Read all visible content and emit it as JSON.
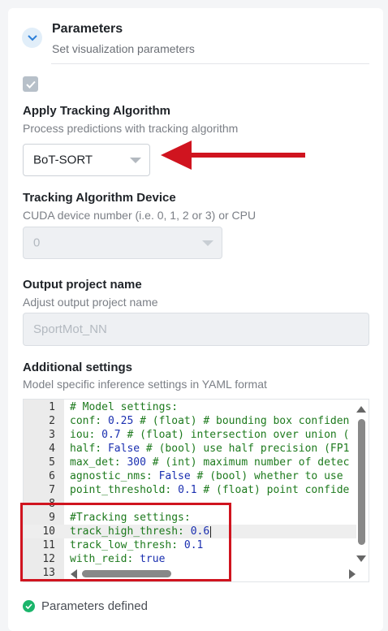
{
  "section": {
    "title": "Parameters",
    "subtitle": "Set visualization parameters"
  },
  "tracking": {
    "label": "Apply Tracking Algorithm",
    "description": "Process predictions with tracking algorithm",
    "enabled": true,
    "algorithm_value": "BoT-SORT"
  },
  "device": {
    "label": "Tracking Algorithm Device",
    "description": "CUDA device number (i.e. 0, 1, 2 or 3) or CPU",
    "value": "0"
  },
  "output": {
    "label": "Output project name",
    "description": "Adjust output project name",
    "placeholder": "SportMot_NN"
  },
  "additional": {
    "label": "Additional settings",
    "description": "Model specific inference settings in YAML format",
    "lines": [
      {
        "n": "1",
        "text": "# Model settings:"
      },
      {
        "n": "2",
        "text": "conf: 0.25 # (float) # bounding box confiden"
      },
      {
        "n": "3",
        "text": "iou: 0.7 # (float) intersection over union ("
      },
      {
        "n": "4",
        "text": "half: False # (bool) use half precision (FP1"
      },
      {
        "n": "5",
        "text": "max_det: 300 # (int) maximum number of detec"
      },
      {
        "n": "6",
        "text": "agnostic_nms: False # (bool) whether to use"
      },
      {
        "n": "7",
        "text": "point_threshold: 0.1 # (float) point confide"
      },
      {
        "n": "8",
        "text": ""
      },
      {
        "n": "9",
        "text": "#Tracking settings:"
      },
      {
        "n": "10",
        "text": "track_high_thresh: 0.6"
      },
      {
        "n": "11",
        "text": "track_low_thresh: 0.1"
      },
      {
        "n": "12",
        "text": "with_reid: true"
      },
      {
        "n": "13",
        "text": ""
      }
    ]
  },
  "status": {
    "text": "Parameters defined",
    "color": "#1bb56b"
  },
  "annotation_color": "#d0141f"
}
